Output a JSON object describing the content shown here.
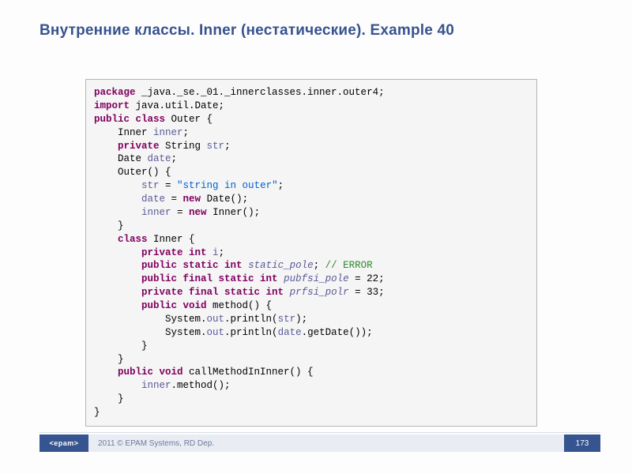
{
  "title": "Внутренние классы. Inner (нестатические). Example 40",
  "code": {
    "l1_kw": "package",
    "l1_rest": " _java._se._01._innerclasses.inner.outer4;",
    "l2_kw": "import",
    "l2_rest": " java.util.Date;",
    "l3_kw": "public class",
    "l3_rest": " Outer {",
    "l4_a": "    Inner ",
    "l4_f": "inner",
    "l4_b": ";",
    "l5_kw": "private",
    "l5_a": " String ",
    "l5_f": "str",
    "l5_b": ";",
    "l6_a": "    Date ",
    "l6_f": "date",
    "l6_b": ";",
    "l7": "    Outer() {",
    "l8_a": "        ",
    "l8_f": "str",
    "l8_b": " = ",
    "l8_s": "\"string in outer\"",
    "l8_c": ";",
    "l9_a": "        ",
    "l9_f": "date",
    "l9_b": " = ",
    "l9_kw": "new",
    "l9_c": " Date();",
    "l10_a": "        ",
    "l10_f": "inner",
    "l10_b": " = ",
    "l10_kw": "new",
    "l10_c": " Inner();",
    "l11": "    }",
    "l12_kw": "class",
    "l12_rest": " Inner {",
    "l13_kw": "private int",
    "l13_a": " ",
    "l13_f": "i",
    "l13_b": ";",
    "l14_kw": "public static int",
    "l14_a": " ",
    "l14_f": "static_pole",
    "l14_b": "; ",
    "l14_c": "// ERROR",
    "l15_kw": "public final static int",
    "l15_a": " ",
    "l15_f": "pubfsi_pole",
    "l15_b": " = 22;",
    "l16_kw": "private final static int",
    "l16_a": " ",
    "l16_f": "prfsi_polr",
    "l16_b": " = 33;",
    "l17_kw": "public void",
    "l17_rest": " method() {",
    "l18_a": "            System.",
    "l18_o": "out",
    "l18_b": ".println(",
    "l18_f": "str",
    "l18_c": ");",
    "l19_a": "            System.",
    "l19_o": "out",
    "l19_b": ".println(",
    "l19_f": "date",
    "l19_c": ".getDate());",
    "l20": "        }",
    "l21": "    }",
    "l22_kw": "public void",
    "l22_rest": " callMethodInInner() {",
    "l23_a": "        ",
    "l23_f": "inner",
    "l23_b": ".method();",
    "l24": "    }",
    "l25": "}"
  },
  "footer": {
    "logo": "<epam>",
    "copyright": "2011 © EPAM Systems, RD Dep.",
    "page": "173"
  }
}
